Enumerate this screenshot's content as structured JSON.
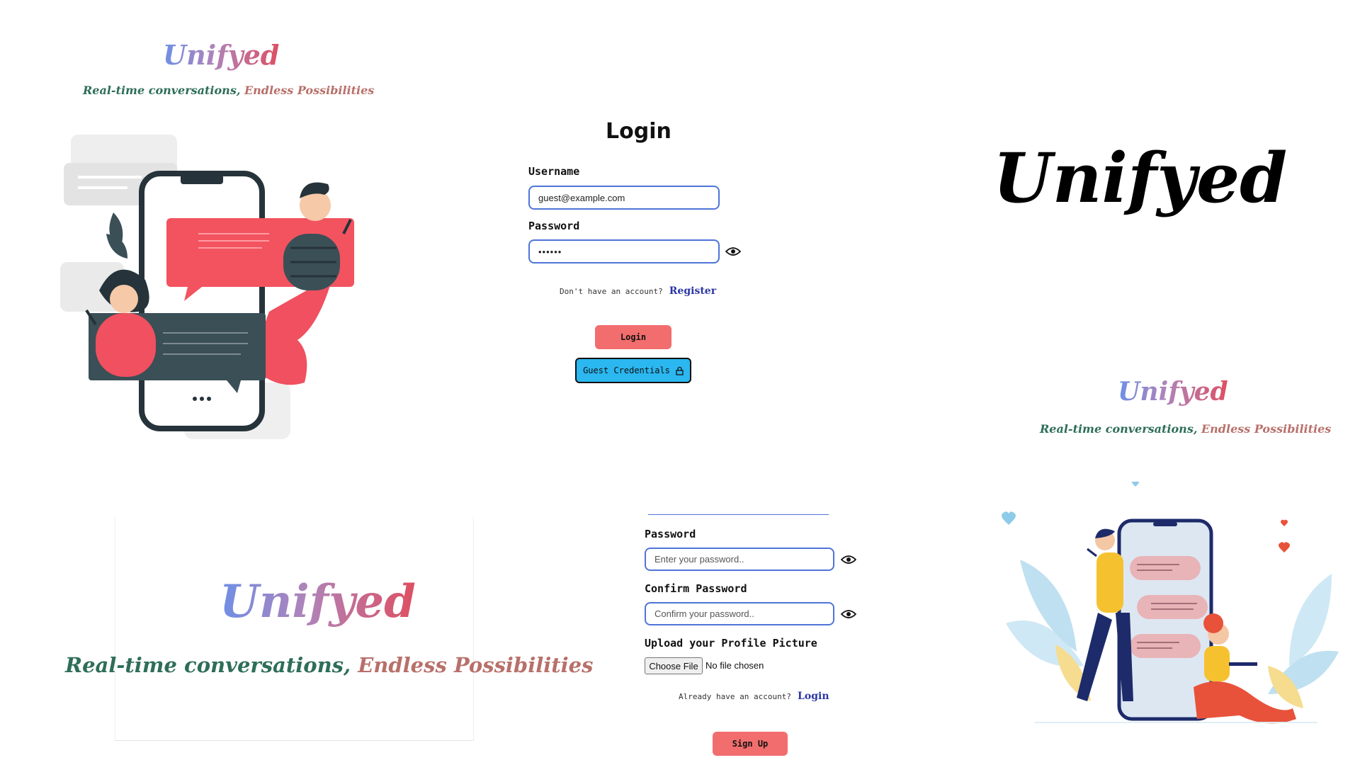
{
  "brand": {
    "name": "Unifyed",
    "tagline_part1": "Real-time conversations,",
    "tagline_part2": "Endless Possibilities"
  },
  "login": {
    "title": "Login",
    "username_label": "Username",
    "username_value": "guest@example.com",
    "password_label": "Password",
    "password_value": "••••••",
    "no_account_text": "Don't have an account?",
    "register_link": "Register",
    "login_button": "Login",
    "guest_button": "Guest Credentials"
  },
  "signup": {
    "password_label": "Password",
    "password_placeholder": "Enter your password..",
    "confirm_label": "Confirm Password",
    "confirm_placeholder": "Confirm your password..",
    "upload_label": "Upload your Profile Picture",
    "choose_file": "Choose File",
    "no_file": "No file chosen",
    "have_account_text": "Already have an account?",
    "login_link": "Login",
    "signup_button": "Sign Up"
  },
  "colors": {
    "accent_red": "#f26d6d",
    "guest_blue": "#2bb7f0",
    "field_border": "#4f74d9",
    "link": "#2b35a3"
  },
  "icons": [
    "eye-icon",
    "lock-icon"
  ]
}
